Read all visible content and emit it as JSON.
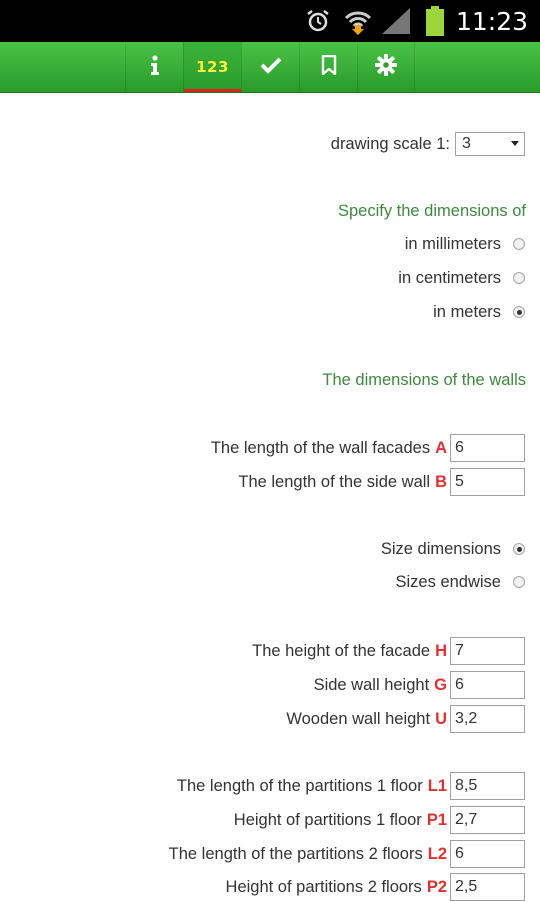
{
  "status_bar": {
    "time": "11:23",
    "icons": [
      "alarm-icon",
      "wifi-icon",
      "signal-icon",
      "battery-icon"
    ]
  },
  "toolbar": {
    "tabs": [
      {
        "name": "info",
        "icon": "info-icon"
      },
      {
        "name": "numbers",
        "label": "123",
        "active": true
      },
      {
        "name": "check",
        "icon": "check-icon"
      },
      {
        "name": "bookmark",
        "icon": "bookmark-icon"
      },
      {
        "name": "settings",
        "icon": "gear-icon"
      }
    ],
    "active_color": "#e02020",
    "background": "#3bb43a"
  },
  "scale": {
    "label": "drawing scale 1:",
    "value": "3"
  },
  "units": {
    "heading": "Specify the dimensions of",
    "options": [
      {
        "label": "in millimeters",
        "checked": false
      },
      {
        "label": "in centimeters",
        "checked": false
      },
      {
        "label": "in meters",
        "checked": true
      }
    ]
  },
  "walls": {
    "heading": "The dimensions of the walls",
    "fields": [
      {
        "label": "The length of the wall facades",
        "letter": "A",
        "value": "6"
      },
      {
        "label": "The length of the side wall",
        "letter": "B",
        "value": "5"
      }
    ]
  },
  "size_mode": {
    "options": [
      {
        "label": "Size dimensions",
        "checked": true
      },
      {
        "label": "Sizes endwise",
        "checked": false
      }
    ]
  },
  "heights": {
    "fields": [
      {
        "label": "The height of the facade",
        "letter": "H",
        "value": "7"
      },
      {
        "label": "Side wall height",
        "letter": "G",
        "value": "6"
      },
      {
        "label": "Wooden wall height",
        "letter": "U",
        "value": "3,2"
      }
    ]
  },
  "partitions": {
    "fields": [
      {
        "label": "The length of the partitions 1 floor",
        "letter": "L1",
        "value": "8,5"
      },
      {
        "label": "Height of partitions 1 floor",
        "letter": "P1",
        "value": "2,7"
      },
      {
        "label": "The length of the partitions 2 floors",
        "letter": "L2",
        "value": "6"
      },
      {
        "label": "Height of partitions 2 floors",
        "letter": "P2",
        "value": "2,5"
      }
    ]
  },
  "colors": {
    "heading_green": "#3e8a3e",
    "letter_red": "#e53030"
  }
}
